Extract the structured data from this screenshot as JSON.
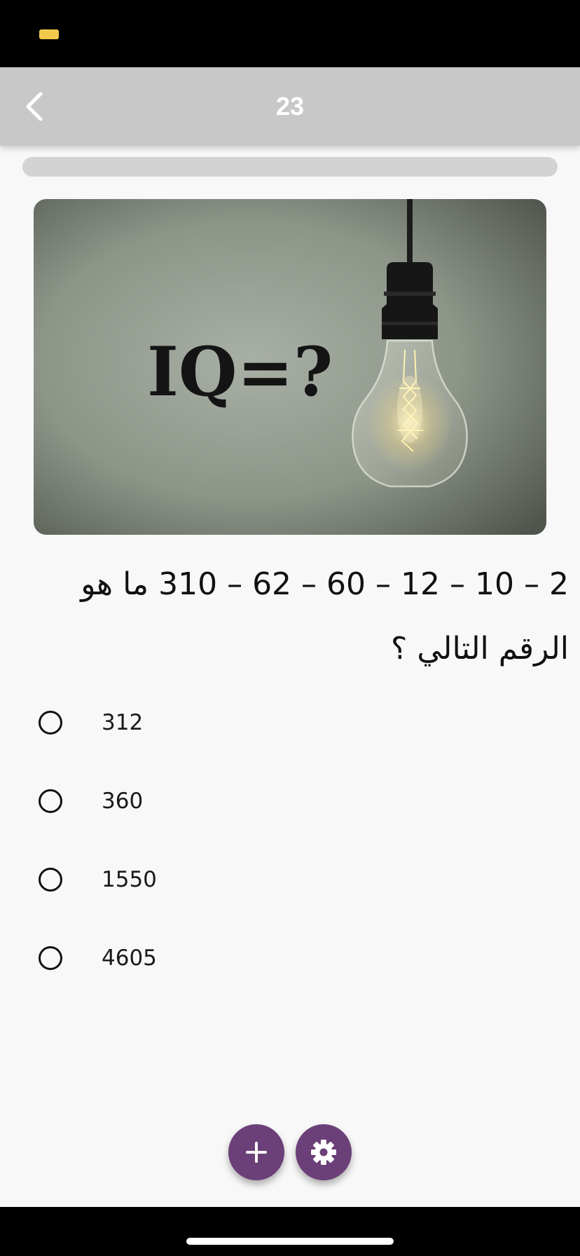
{
  "status_bar": {
    "battery_color": "#f2c94c"
  },
  "app_bar": {
    "title": "23",
    "back_icon": "chevron-left-icon",
    "background": "#c8c8c8"
  },
  "progress": {
    "fraction": 0.0
  },
  "question": {
    "image": {
      "caption_text": "IQ=?",
      "subject": "light bulb"
    },
    "text": "2 – 10 – 12 – 60 – 62 – 310 ما هو الرقم التالي ؟"
  },
  "options": [
    {
      "label": "312",
      "selected": false
    },
    {
      "label": "360",
      "selected": false
    },
    {
      "label": "1550",
      "selected": false
    },
    {
      "label": "4605",
      "selected": false
    }
  ],
  "fabs": {
    "add_icon": "plus-icon",
    "settings_icon": "gear-icon",
    "color": "#6b3f78"
  }
}
